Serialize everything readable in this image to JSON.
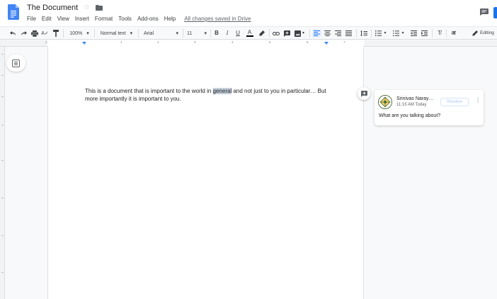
{
  "document": {
    "title": "The Document",
    "save_status": "All changes saved in Drive"
  },
  "menu": [
    "File",
    "Edit",
    "View",
    "Insert",
    "Format",
    "Tools",
    "Add-ons",
    "Help"
  ],
  "toolbar": {
    "zoom": "100%",
    "style": "Normal text",
    "font": "Arial",
    "font_size": "11",
    "mode": "Editing",
    "font_glyph": "अ",
    "icons": [
      "undo-icon",
      "redo-icon",
      "print-icon",
      "spellcheck-icon",
      "paint-format-icon",
      "bold-icon",
      "italic-icon",
      "underline-icon",
      "text-color-icon",
      "highlight-icon",
      "link-icon",
      "comment-icon",
      "image-icon",
      "align-left-icon",
      "align-center-icon",
      "align-right-icon",
      "justify-icon",
      "line-spacing-icon",
      "numbered-list-icon",
      "bulleted-list-icon",
      "decrease-indent-icon",
      "increase-indent-icon",
      "clear-formatting-icon",
      "pencil-icon"
    ]
  },
  "ruler": {
    "numbers": [
      "1",
      "1",
      "2",
      "3",
      "4",
      "5",
      "6",
      "7"
    ]
  },
  "body": {
    "text_before": "This is a document that is important to the world in ",
    "highlighted": "general",
    "text_after": " and not just to you in particular… But more importantly it is important to you."
  },
  "comment": {
    "author": "Srinivas Naray…",
    "time": "11:15 AM Today",
    "resolve_label": "Resolve",
    "text": "What are you talking about?"
  },
  "colors": {
    "accent": "#1a73e8",
    "highlight": "#c5d0dc",
    "avatar_border": "#4a6b35"
  }
}
